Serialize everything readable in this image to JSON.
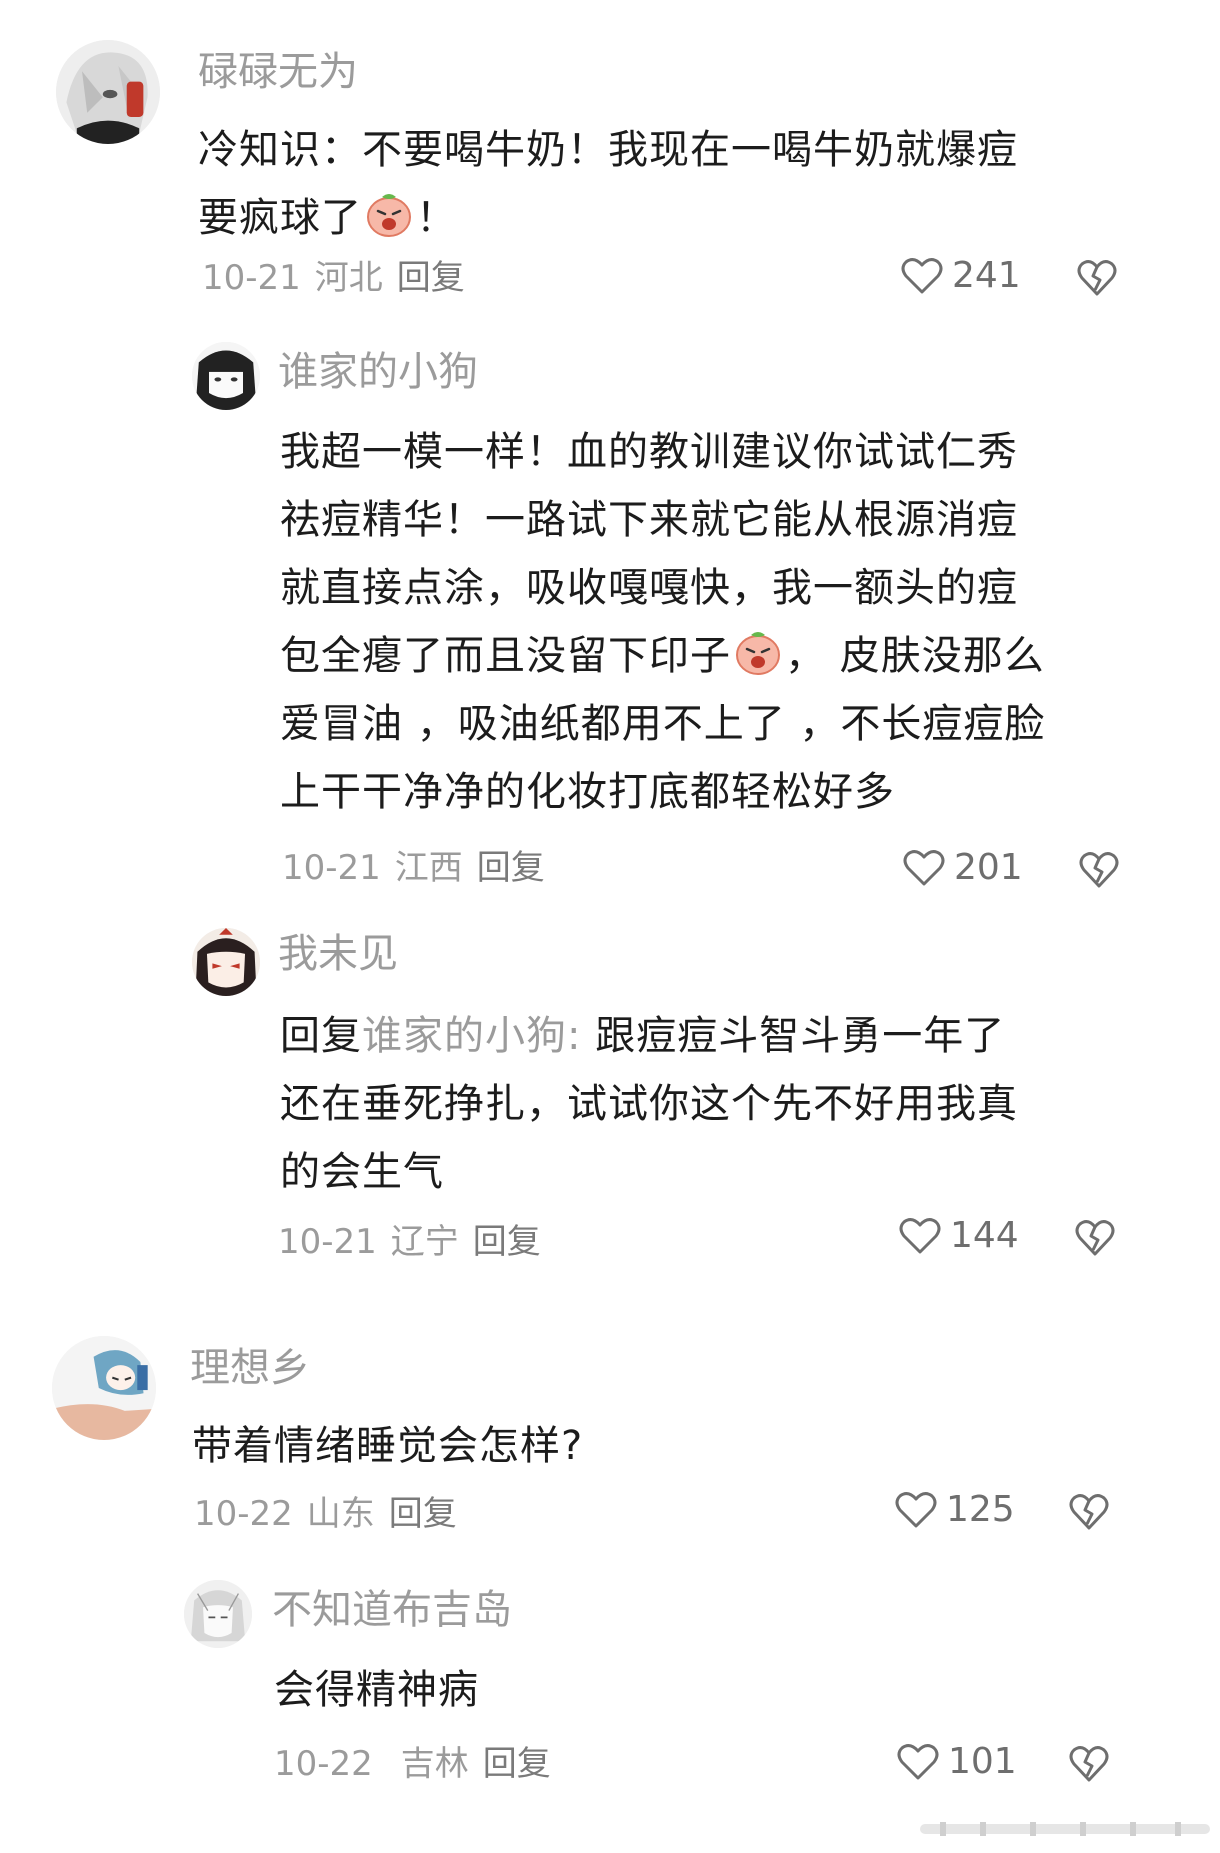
{
  "comments": [
    {
      "username": "碌碌无为",
      "lines": [
        "冷知识：不要喝牛奶！我现在一喝牛奶就爆痘",
        "要疯球了",
        "！"
      ],
      "emoji_name": "angry-face-emoji",
      "date": "10-21",
      "location": "河北",
      "reply_label": "回复",
      "likes": "241",
      "avatar_name": "anime-white-hair-avatar"
    },
    {
      "username": "谁家的小狗",
      "lines": [
        "我超一模一样！血的教训建议你试试仁秀",
        "祛痘精华！一路试下来就它能从根源消痘",
        "就直接点涂，吸收嘎嘎快，我一额头的痘",
        "包全瘪了而且没留下印子",
        "， 皮肤没那么",
        "爱冒油 ，吸油纸都用不上了 ，不长痘痘脸",
        "上干干净净的化妆打底都轻松好多"
      ],
      "emoji_name": "angry-face-emoji",
      "date": "10-21",
      "location": "江西",
      "reply_label": "回复",
      "likes": "201",
      "avatar_name": "anime-black-hair-avatar"
    },
    {
      "username": "我未见",
      "reply_prefix": "回复",
      "reply_target": "谁家的小狗:",
      "lines": [
        "跟痘痘斗智斗勇一年了",
        "还在垂死挣扎，试试你这个先不好用我真",
        "的会生气"
      ],
      "date": "10-21",
      "location": "辽宁",
      "reply_label": "回复",
      "likes": "144",
      "avatar_name": "anime-red-eyes-avatar"
    },
    {
      "username": "理想乡",
      "lines": [
        "带着情绪睡觉会怎样?"
      ],
      "date": "10-22",
      "location": "山东",
      "reply_label": "回复",
      "likes": "125",
      "avatar_name": "anime-sleeping-girl-avatar"
    },
    {
      "username": "不知道布吉岛",
      "lines": [
        "会得精神病"
      ],
      "date": "10-22",
      "location": "吉林",
      "reply_label": "回复",
      "likes": "101",
      "avatar_name": "anime-sketch-avatar"
    }
  ],
  "colors": {
    "text": "#1c1c1c",
    "muted": "#9b9b9b",
    "icon": "#6e6e6e"
  }
}
